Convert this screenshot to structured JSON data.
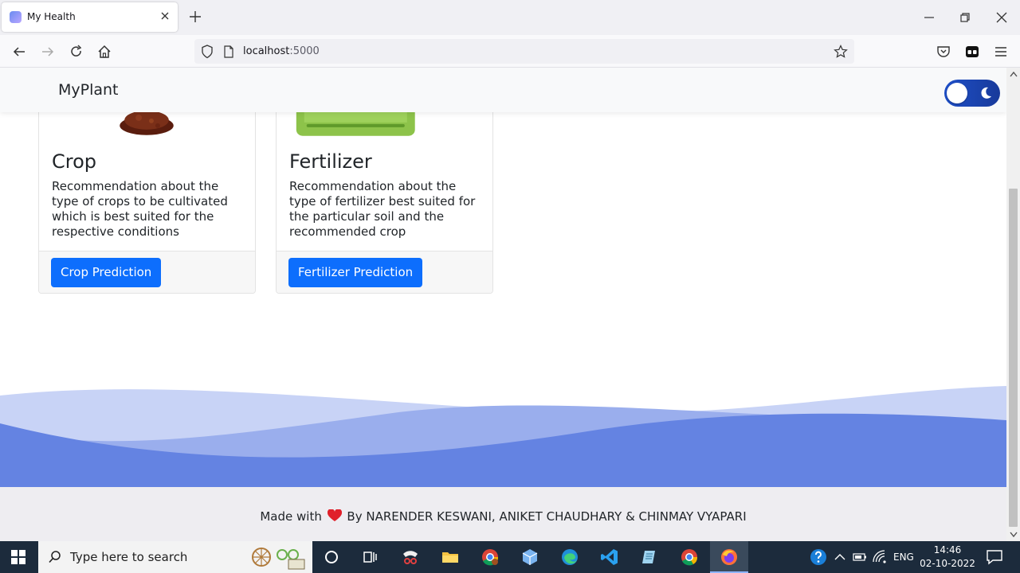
{
  "browser": {
    "tab_title": "My Health",
    "url_host": "localhost",
    "url_port": ":5000"
  },
  "site": {
    "brand": "MyPlant",
    "theme_toggle": "dark-mode-toggle"
  },
  "cards": [
    {
      "title": "Crop",
      "text": "Recommendation about the type of crops to be cultivated which is best suited for the respective conditions",
      "button": "Crop Prediction",
      "image_icon": "soil-icon"
    },
    {
      "title": "Fertilizer",
      "text": "Recommendation about the type of fertilizer best suited for the particular soil and the recommended crop",
      "button": "Fertilizer Prediction",
      "image_icon": "fertilizer-bag-icon"
    }
  ],
  "footer": {
    "prefix": "Made with",
    "suffix": "By NARENDER KESWANI, ANIKET CHAUDHARY & CHINMAY VYAPARI",
    "heart_color": "#e0202a"
  },
  "colors": {
    "primary_button": "#0d6efd",
    "wave_light": "#c8d3f6",
    "wave_mid": "#9aaeed",
    "wave_dark": "#6483e2"
  },
  "taskbar": {
    "search_placeholder": "Type here to search",
    "language": "ENG",
    "time": "14:46",
    "date": "02-10-2022"
  }
}
